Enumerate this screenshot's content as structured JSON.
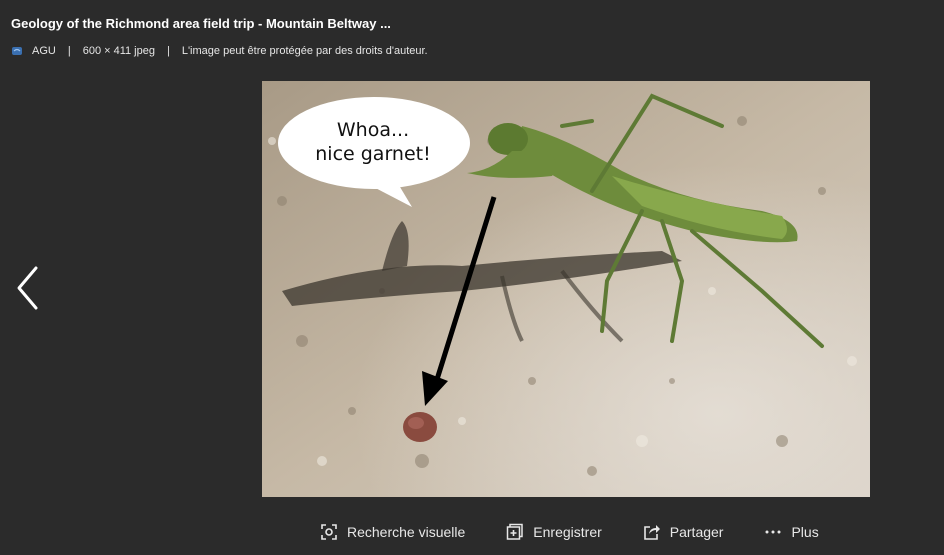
{
  "header": {
    "title": "Geology of the Richmond area field trip - Mountain Beltway ...",
    "source_name": "AGU",
    "separator": "|",
    "image_info": "600 × 411 jpeg",
    "copyright_note": "L'image peut être protégée par des droits d'auteur."
  },
  "image": {
    "speech_line_1": "Whoa...",
    "speech_line_2": "nice garnet!"
  },
  "actions": {
    "visual_search": "Recherche visuelle",
    "save": "Enregistrer",
    "share": "Partager",
    "more": "Plus"
  },
  "icons": {
    "prev": "chevron-left-icon",
    "source": "source-favicon-icon",
    "visual_search": "visual-search-icon",
    "save": "add-collection-icon",
    "share": "share-icon",
    "more": "more-dots-icon"
  },
  "colors": {
    "background": "#2b2b2b",
    "text": "#ffffff",
    "favicon": "#3a6fb0"
  }
}
